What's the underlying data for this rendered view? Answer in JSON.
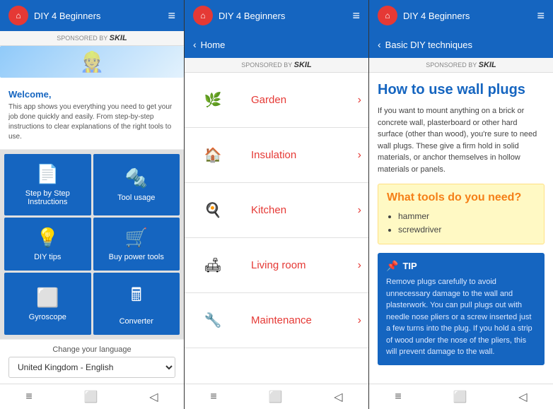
{
  "app": {
    "name": "DIY 4 Beginners",
    "sponsored_label": "SPONSORED BY",
    "sponsor_name": "SKIL"
  },
  "screen1": {
    "welcome_title": "Welcome,",
    "welcome_text": "This app shows you everything you need to get your job done quickly and easily. From step-by-step instructions to clear explanations of the right tools to use.",
    "grid_items": [
      {
        "id": "step-by-step",
        "label": "Step by Step Instructions",
        "icon": "📄"
      },
      {
        "id": "tool-usage",
        "label": "Tool usage",
        "icon": "🔧"
      },
      {
        "id": "diy-tips",
        "label": "DIY tips",
        "icon": "💡"
      },
      {
        "id": "buy-tools",
        "label": "Buy power tools",
        "icon": "🛒"
      },
      {
        "id": "gyroscope",
        "label": "Gyroscope",
        "icon": "⬜"
      },
      {
        "id": "converter",
        "label": "Converter",
        "icon": "🖩"
      }
    ],
    "language_label": "Change your language",
    "language_value": "United Kingdom - English"
  },
  "screen2": {
    "back_label": "Home",
    "categories": [
      {
        "id": "garden",
        "name": "Garden",
        "thumb_class": "garden",
        "emoji": "🌿"
      },
      {
        "id": "insulation",
        "name": "Insulation",
        "thumb_class": "insulation",
        "emoji": "🏠"
      },
      {
        "id": "kitchen",
        "name": "Kitchen",
        "thumb_class": "kitchen",
        "emoji": "🍳"
      },
      {
        "id": "living-room",
        "name": "Living room",
        "thumb_class": "living",
        "emoji": "🛋"
      },
      {
        "id": "maintenance",
        "name": "Maintenance",
        "thumb_class": "maintenance",
        "emoji": "🔧"
      }
    ]
  },
  "screen3": {
    "back_label": "Basic DIY techniques",
    "article_title": "How to use wall plugs",
    "article_text": "If you want to mount anything on a brick or concrete wall, plasterboard or other hard surface (other than wood), you're sure to need wall plugs. These give a firm hold in solid materials, or anchor themselves in hollow materials or panels.",
    "tools_box": {
      "title": "What tools do you need?",
      "tools": [
        "hammer",
        "screwdriver"
      ]
    },
    "tip": {
      "label": "TIP",
      "text": "Remove plugs carefully to avoid unnecessary damage to the wall and plasterwork. You can pull plugs out with needle nose pliers or a screw inserted just a few turns into the plug. If you hold a strip of wood under the nose of the pliers, this will prevent damage to the wall."
    }
  }
}
